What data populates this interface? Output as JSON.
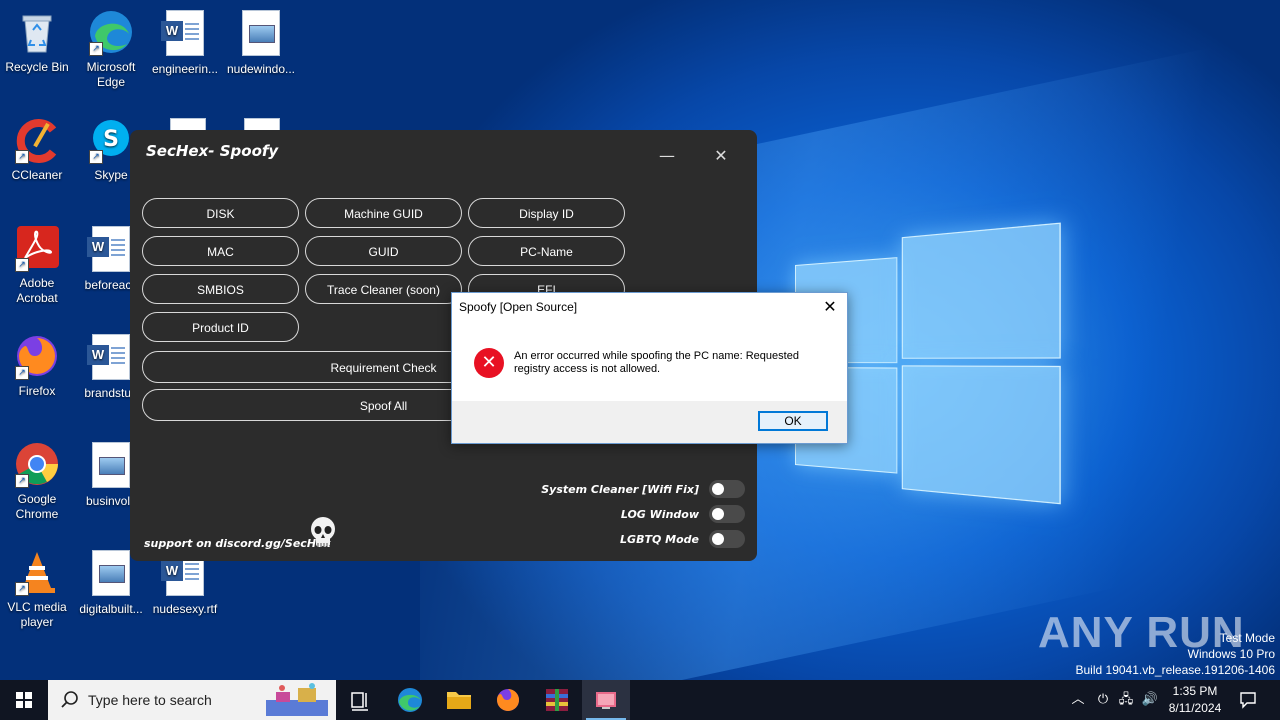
{
  "desktop": {
    "icons": [
      {
        "label": "Recycle Bin"
      },
      {
        "label": "Microsoft Edge"
      },
      {
        "label": "engineerin..."
      },
      {
        "label": "nudewindo..."
      },
      {
        "label": "CCleaner"
      },
      {
        "label": "Skype"
      },
      {
        "label": "Adobe Acrobat"
      },
      {
        "label": "beforeacc"
      },
      {
        "label": "Firefox"
      },
      {
        "label": "brandstud"
      },
      {
        "label": "Google Chrome"
      },
      {
        "label": "businvolv"
      },
      {
        "label": "VLC media player"
      },
      {
        "label": "digitalbuilt..."
      },
      {
        "label": "nudesexy.rtf"
      }
    ]
  },
  "app": {
    "title": "SecHex- Spoofy",
    "minimize": "—",
    "close": "✕",
    "buttons": {
      "disk": "DISK",
      "machine_guid": "Machine GUID",
      "display_id": "Display ID",
      "mac": "MAC",
      "guid": "GUID",
      "pc_name": "PC-Name",
      "smbios": "SMBIOS",
      "trace_cleaner": "Trace Cleaner (soon)",
      "efi": "EFI",
      "product_id": "Product ID",
      "requirement_check": "Requirement Check",
      "spoof_all": "Spoof All"
    },
    "toggles": {
      "system_cleaner": "System Cleaner [Wifi Fix]",
      "log_window": "LOG Window",
      "lgbtq_mode": "LGBTQ Mode"
    },
    "support": "support on discord.gg/SecHex"
  },
  "dialog": {
    "title": "Spoofy [Open Source]",
    "close": "✕",
    "message": "An error occurred while spoofing the PC name: Requested registry access is not allowed.",
    "ok": "OK"
  },
  "watermark": {
    "brand": "ANY RUN",
    "test_mode": "Test Mode",
    "edition": "Windows 10 Pro",
    "build": "Build 19041.vb_release.191206-1406"
  },
  "taskbar": {
    "search_placeholder": "Type here to search",
    "time": "1:35 PM",
    "date": "8/11/2024"
  }
}
